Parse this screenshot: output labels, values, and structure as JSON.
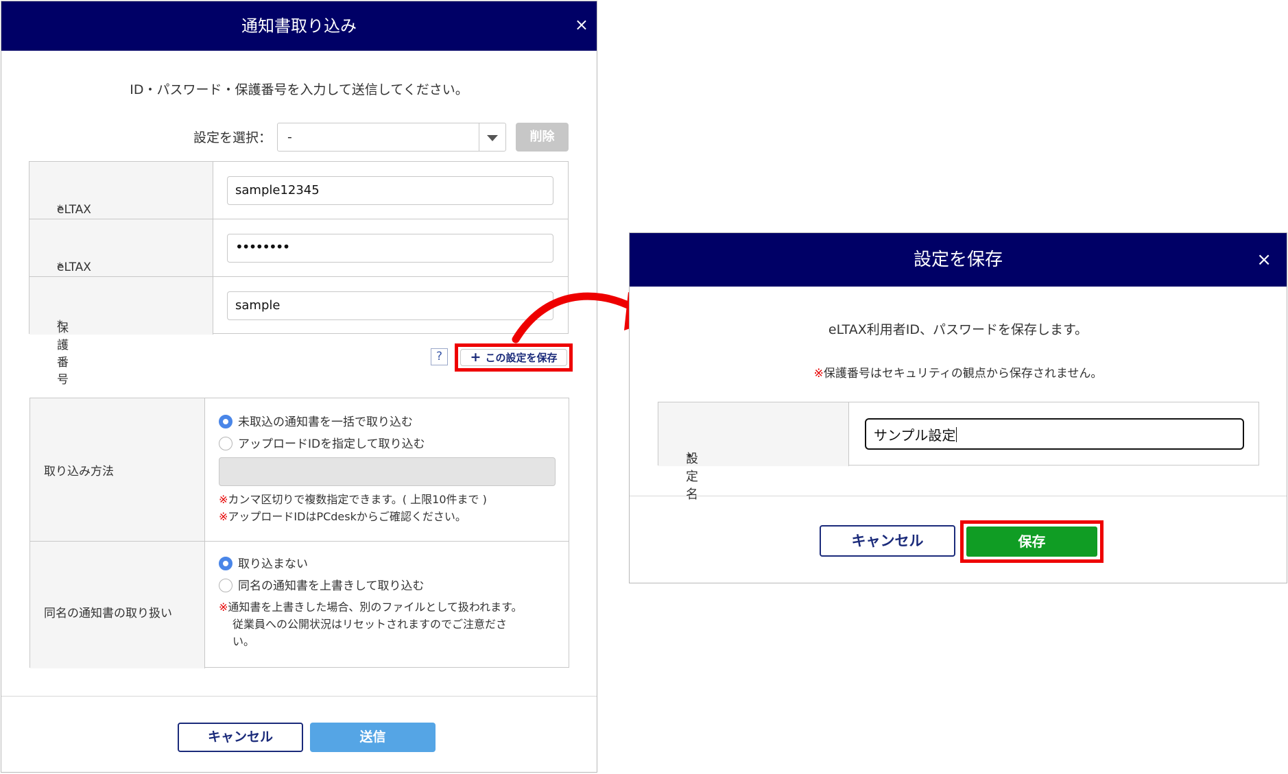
{
  "import_dialog": {
    "title": "通知書取り込み",
    "close": "×",
    "intro": "ID・パスワード・保護番号を入力して送信してください。",
    "preset_label": "設定を選択：",
    "preset_value": "-",
    "delete_label": "削除",
    "required_mark": "*",
    "fields": [
      {
        "label": "eLTAX利用者ID",
        "value": "sample12345"
      },
      {
        "label": "eLTAXのパスワード",
        "value": "••••••••"
      },
      {
        "label": "保護番号",
        "value": "sample"
      }
    ],
    "help_label": "?",
    "save_setting_label": "この設定を保存",
    "save_setting_plus": "+",
    "method": {
      "label": "取り込み方法",
      "option1": "未取込の通知書を一括で取り込む",
      "option2": "アップロードIDを指定して取り込む",
      "note1": "カンマ区切りで複数指定できます。( 上限10件まで )",
      "note2": "アップロードIDはPCdeskからご確認ください。"
    },
    "same_name": {
      "label": "同名の通知書の取り扱い",
      "option1": "取り込まない",
      "option2": "同名の通知書を上書きして取り込む",
      "note_line1": "通知書を上書きした場合、別のファイルとして扱われます。",
      "note_line2": "従業員への公開状況はリセットされますのでご注意ださ",
      "note_line3": "い。"
    },
    "note_mark": "※",
    "cancel_label": "キャンセル",
    "send_label": "送信"
  },
  "save_dialog": {
    "title": "設定を保存",
    "close": "×",
    "intro": "eLTAX利用者ID、パスワードを保存します。",
    "warn_mark": "※",
    "warn": "保護番号はセキュリティの観点から保存されません。",
    "required_mark": "•",
    "name_label": "設定名",
    "name_value": "サンプル設定",
    "cancel_label": "キャンセル",
    "save_label": "保存"
  },
  "colors": {
    "header_bg": "#000066",
    "highlight": "#ee0000",
    "save_button": "#109d24",
    "send_button": "#55a5e5"
  }
}
